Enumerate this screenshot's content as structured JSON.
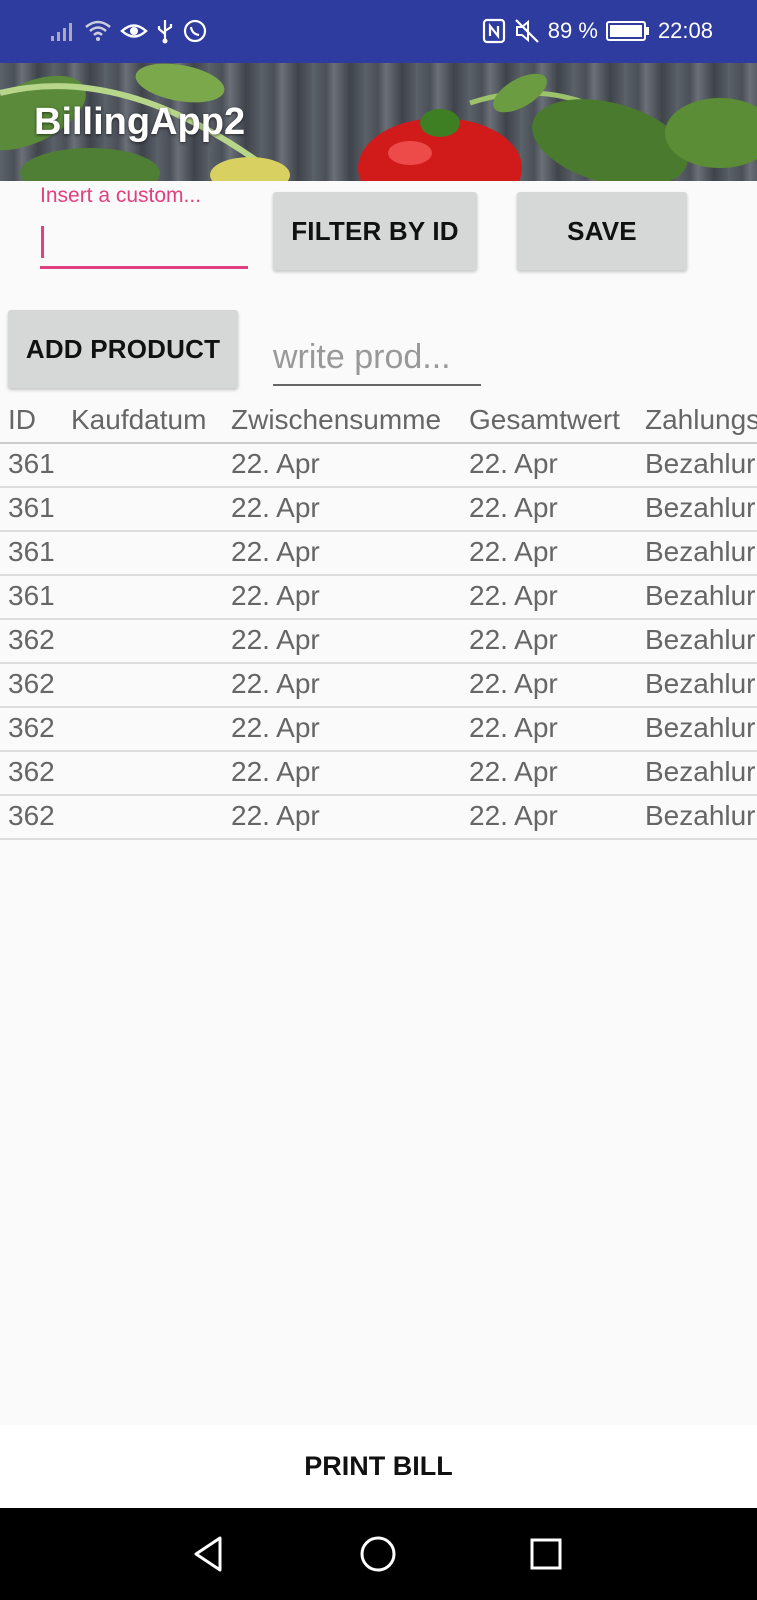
{
  "status_bar": {
    "battery": "89 %",
    "time": "22:08"
  },
  "app": {
    "title": "BillingApp2"
  },
  "customer_field": {
    "label": "Insert a custom...",
    "value": ""
  },
  "buttons": {
    "filter": "FILTER BY ID",
    "save": "SAVE",
    "add_product": "ADD PRODUCT",
    "print_bill": "PRINT BILL"
  },
  "product_field": {
    "placeholder": "write prod...",
    "value": ""
  },
  "table": {
    "columns": [
      "ID",
      "Kaufdatum",
      "Zwischensumme",
      "Gesamtwert",
      "Zahlungs"
    ],
    "rows": [
      [
        "361",
        "",
        "22. Apr",
        "22. Apr",
        "Bezahlur"
      ],
      [
        "361",
        "",
        "22. Apr",
        "22. Apr",
        "Bezahlur"
      ],
      [
        "361",
        "",
        "22. Apr",
        "22. Apr",
        "Bezahlur"
      ],
      [
        "361",
        "",
        "22. Apr",
        "22. Apr",
        "Bezahlur"
      ],
      [
        "362",
        "",
        "22. Apr",
        "22. Apr",
        "Bezahlur"
      ],
      [
        "362",
        "",
        "22. Apr",
        "22. Apr",
        "Bezahlur"
      ],
      [
        "362",
        "",
        "22. Apr",
        "22. Apr",
        "Bezahlur"
      ],
      [
        "362",
        "",
        "22. Apr",
        "22. Apr",
        "Bezahlur"
      ],
      [
        "362",
        "",
        "22. Apr",
        "22. Apr",
        "Bezahlur"
      ]
    ]
  },
  "colors": {
    "status_bar": "#2d3c9e",
    "accent": "#e0407f",
    "button": "#d6d7d7"
  }
}
